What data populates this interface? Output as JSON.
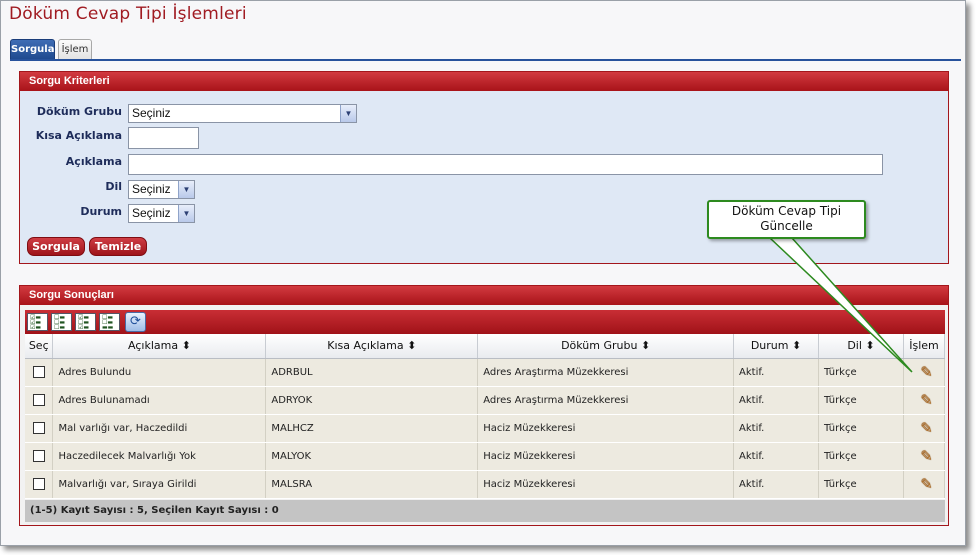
{
  "page": {
    "title": "Döküm Cevap Tipi İşlemleri"
  },
  "tabs": [
    {
      "label": "Sorgula"
    },
    {
      "label": "İşlem"
    }
  ],
  "criteria": {
    "header": "Sorgu Kriterleri",
    "fields": {
      "dokum_grubu": {
        "label": "Döküm Grubu",
        "value": "Seçiniz"
      },
      "kisa_aciklama": {
        "label": "Kısa Açıklama",
        "value": ""
      },
      "aciklama": {
        "label": "Açıklama",
        "value": ""
      },
      "dil": {
        "label": "Dil",
        "value": "Seçiniz"
      },
      "durum": {
        "label": "Durum",
        "value": "Seçiniz"
      }
    },
    "buttons": {
      "search": "Sorgula",
      "clear": "Temizle"
    }
  },
  "callout": {
    "text_line1": "Döküm Cevap Tipi",
    "text_line2": "Güncelle"
  },
  "results": {
    "header": "Sorgu Sonuçları",
    "toolbar_icons": [
      "select-all-icon",
      "deselect-all-icon",
      "invert-selection-icon",
      "clear-selection-icon",
      "refresh-icon"
    ],
    "columns": {
      "sec": "Seç",
      "aciklama": "Açıklama",
      "kisa": "Kısa Açıklama",
      "grup": "Döküm Grubu",
      "durum": "Durum",
      "dil": "Dil",
      "islem": "İşlem"
    },
    "sort_icon": "⬍",
    "rows": [
      {
        "aciklama": "Adres Bulundu",
        "kisa": "ADRBUL",
        "grup": "Adres Araştırma Müzekkeresi",
        "durum": "Aktif.",
        "dil": "Türkçe"
      },
      {
        "aciklama": "Adres Bulunamadı",
        "kisa": "ADRYOK",
        "grup": "Adres Araştırma Müzekkeresi",
        "durum": "Aktif.",
        "dil": "Türkçe"
      },
      {
        "aciklama": "Mal varlığı var, Haczedildi",
        "kisa": "MALHCZ",
        "grup": "Haciz Müzekkeresi",
        "durum": "Aktif.",
        "dil": "Türkçe"
      },
      {
        "aciklama": "Haczedilecek Malvarlığı Yok",
        "kisa": "MALYOK",
        "grup": "Haciz Müzekkeresi",
        "durum": "Aktif.",
        "dil": "Türkçe"
      },
      {
        "aciklama": "Malvarlığı var, Sıraya Girildi",
        "kisa": "MALSRA",
        "grup": "Haciz Müzekkeresi",
        "durum": "Aktif.",
        "dil": "Türkçe"
      }
    ],
    "footer": "(1-5) Kayıt Sayısı : 5, Seçilen Kayıt Sayısı : 0"
  }
}
